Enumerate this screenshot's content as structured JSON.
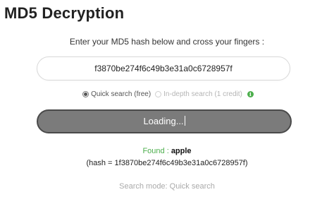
{
  "page": {
    "title": "MD5 Decryption",
    "instructions": "Enter your MD5 hash below and cross your fingers :"
  },
  "hash_input": {
    "value": "f3870be274f6c49b3e31a0c6728957f"
  },
  "search_options": [
    {
      "label": "Quick search (free)",
      "checked": true,
      "enabled": true
    },
    {
      "label": "In-depth search (1 credit)",
      "checked": false,
      "enabled": false
    }
  ],
  "info_icon": {
    "icon": "info-icon",
    "glyph": "i",
    "color": "#4cae4c"
  },
  "button": {
    "label": "Loading..."
  },
  "result": {
    "found_label": "Found",
    "separator": " : ",
    "found_value": "apple",
    "hash_line": "(hash = 1f3870be274f6c49b3e31a0c6728957f)",
    "search_mode": "Search mode: Quick search"
  },
  "colors": {
    "accent_green": "#4cae4c",
    "button_bg": "#7b7b7b",
    "button_border": "#4a4a4a",
    "muted_text": "#aaaaaa"
  }
}
